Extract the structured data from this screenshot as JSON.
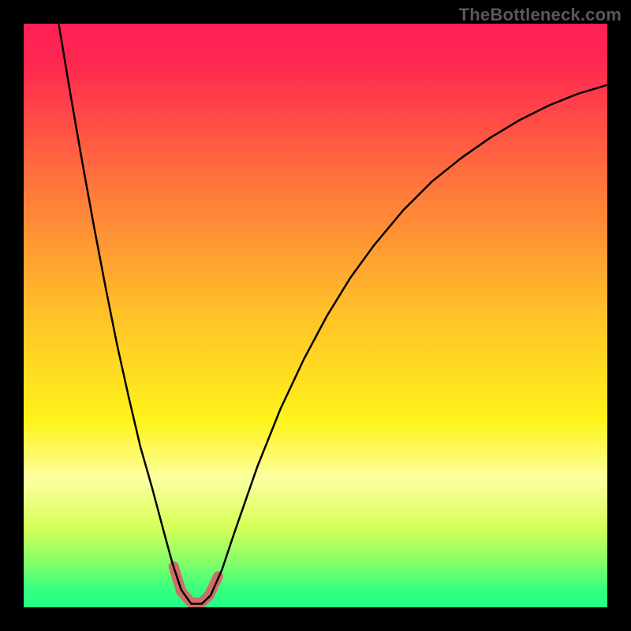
{
  "watermark": "TheBottleneck.com",
  "chart_data": {
    "type": "line",
    "title": "",
    "xlabel": "",
    "ylabel": "",
    "xlim": [
      0,
      100
    ],
    "ylim": [
      0,
      100
    ],
    "grid": false,
    "legend": false,
    "background_gradient": [
      {
        "stop": 0.0,
        "color": "#ff1f55"
      },
      {
        "stop": 0.07,
        "color": "#ff2850"
      },
      {
        "stop": 0.3,
        "color": "#ff7e3a"
      },
      {
        "stop": 0.5,
        "color": "#ffc228"
      },
      {
        "stop": 0.68,
        "color": "#fff31a"
      },
      {
        "stop": 0.78,
        "color": "#fcffa0"
      },
      {
        "stop": 0.86,
        "color": "#d8ff5a"
      },
      {
        "stop": 0.92,
        "color": "#88ff67"
      },
      {
        "stop": 0.97,
        "color": "#35ff80"
      },
      {
        "stop": 1.0,
        "color": "#22ff87"
      }
    ],
    "series": [
      {
        "name": "bottleneck-curve",
        "stroke": "#000000",
        "stroke_width": 2.5,
        "points": [
          {
            "x": 6.0,
            "y": 100.0
          },
          {
            "x": 8.0,
            "y": 88.0
          },
          {
            "x": 10.0,
            "y": 76.5
          },
          {
            "x": 12.0,
            "y": 65.5
          },
          {
            "x": 14.0,
            "y": 55.0
          },
          {
            "x": 16.0,
            "y": 45.0
          },
          {
            "x": 18.0,
            "y": 36.0
          },
          {
            "x": 20.0,
            "y": 27.5
          },
          {
            "x": 22.0,
            "y": 20.5
          },
          {
            "x": 24.0,
            "y": 13.0
          },
          {
            "x": 25.5,
            "y": 7.5
          },
          {
            "x": 27.0,
            "y": 3.0
          },
          {
            "x": 28.7,
            "y": 0.6
          },
          {
            "x": 30.5,
            "y": 0.6
          },
          {
            "x": 32.0,
            "y": 2.0
          },
          {
            "x": 34.0,
            "y": 6.5
          },
          {
            "x": 36.0,
            "y": 12.5
          },
          {
            "x": 40.0,
            "y": 24.0
          },
          {
            "x": 44.0,
            "y": 34.0
          },
          {
            "x": 48.0,
            "y": 42.5
          },
          {
            "x": 52.0,
            "y": 50.0
          },
          {
            "x": 56.0,
            "y": 56.5
          },
          {
            "x": 60.0,
            "y": 62.0
          },
          {
            "x": 65.0,
            "y": 68.0
          },
          {
            "x": 70.0,
            "y": 73.0
          },
          {
            "x": 75.0,
            "y": 77.0
          },
          {
            "x": 80.0,
            "y": 80.5
          },
          {
            "x": 85.0,
            "y": 83.5
          },
          {
            "x": 90.0,
            "y": 86.0
          },
          {
            "x": 95.0,
            "y": 88.0
          },
          {
            "x": 100.0,
            "y": 89.5
          }
        ]
      },
      {
        "name": "valley-highlight",
        "stroke": "#cf6d6a",
        "stroke_width": 13,
        "linecap": "round",
        "points": [
          {
            "x": 25.7,
            "y": 7.0
          },
          {
            "x": 27.0,
            "y": 2.7
          },
          {
            "x": 28.7,
            "y": 0.8
          },
          {
            "x": 30.5,
            "y": 0.8
          },
          {
            "x": 31.8,
            "y": 2.1
          },
          {
            "x": 33.3,
            "y": 5.3
          }
        ]
      }
    ]
  }
}
